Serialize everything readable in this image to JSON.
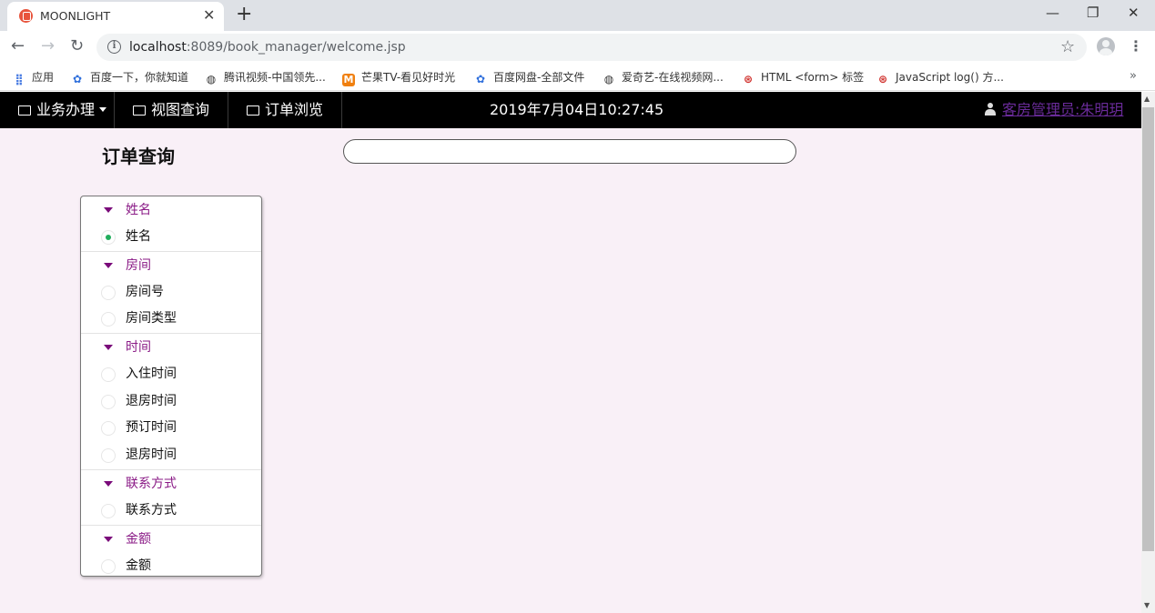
{
  "browser": {
    "tab_title": "MOONLIGHT",
    "tab_close": "✕",
    "new_tab": "+",
    "window": {
      "minimize": "—",
      "restore": "❐",
      "close": "✕"
    },
    "url_host": "localhost",
    "url_rest": ":8089/book_manager/welcome.jsp",
    "bookmarks": [
      {
        "label": "应用",
        "icon": "apps-grid-icon"
      },
      {
        "label": "百度一下，你就知道",
        "icon": "baidu-paw-icon"
      },
      {
        "label": "腾讯视频-中国领先...",
        "icon": "globe-icon"
      },
      {
        "label": "芒果TV-看见好时光",
        "icon": "mango-tv-icon"
      },
      {
        "label": "百度网盘-全部文件",
        "icon": "baidu-paw-icon"
      },
      {
        "label": "爱奇艺-在线视频网...",
        "icon": "globe-icon"
      },
      {
        "label": "HTML <form> 标签",
        "icon": "w3school-icon"
      },
      {
        "label": "JavaScript log() 方...",
        "icon": "w3school-icon"
      }
    ],
    "bookmarks_more": "»"
  },
  "app": {
    "nav": {
      "business": "业务办理",
      "view_query": "视图查询",
      "order_browse": "订单浏览",
      "clock": "2019年7月04日10:27:45",
      "user": "客房管理员:朱明玥"
    },
    "page_title": "订单查询",
    "search": {
      "value": "",
      "placeholder": ""
    },
    "filters": [
      {
        "header": "姓名",
        "options": [
          {
            "label": "姓名",
            "checked": true
          }
        ]
      },
      {
        "header": "房间",
        "options": [
          {
            "label": "房间号",
            "checked": false
          },
          {
            "label": "房间类型",
            "checked": false
          }
        ]
      },
      {
        "header": "时间",
        "options": [
          {
            "label": "入住时间",
            "checked": false
          },
          {
            "label": "退房时间",
            "checked": false
          },
          {
            "label": "预订时间",
            "checked": false
          },
          {
            "label": "退房时间",
            "checked": false
          }
        ]
      },
      {
        "header": "联系方式",
        "options": [
          {
            "label": "联系方式",
            "checked": false
          }
        ]
      },
      {
        "header": "金额",
        "options": [
          {
            "label": "金额",
            "checked": false
          }
        ]
      }
    ]
  },
  "colors": {
    "page_bg": "#f9f0f7",
    "nav_bg": "#000000",
    "group_header": "#8a1a86",
    "radio_checked": "#21ad5c",
    "user_link": "#6a2b9a"
  }
}
